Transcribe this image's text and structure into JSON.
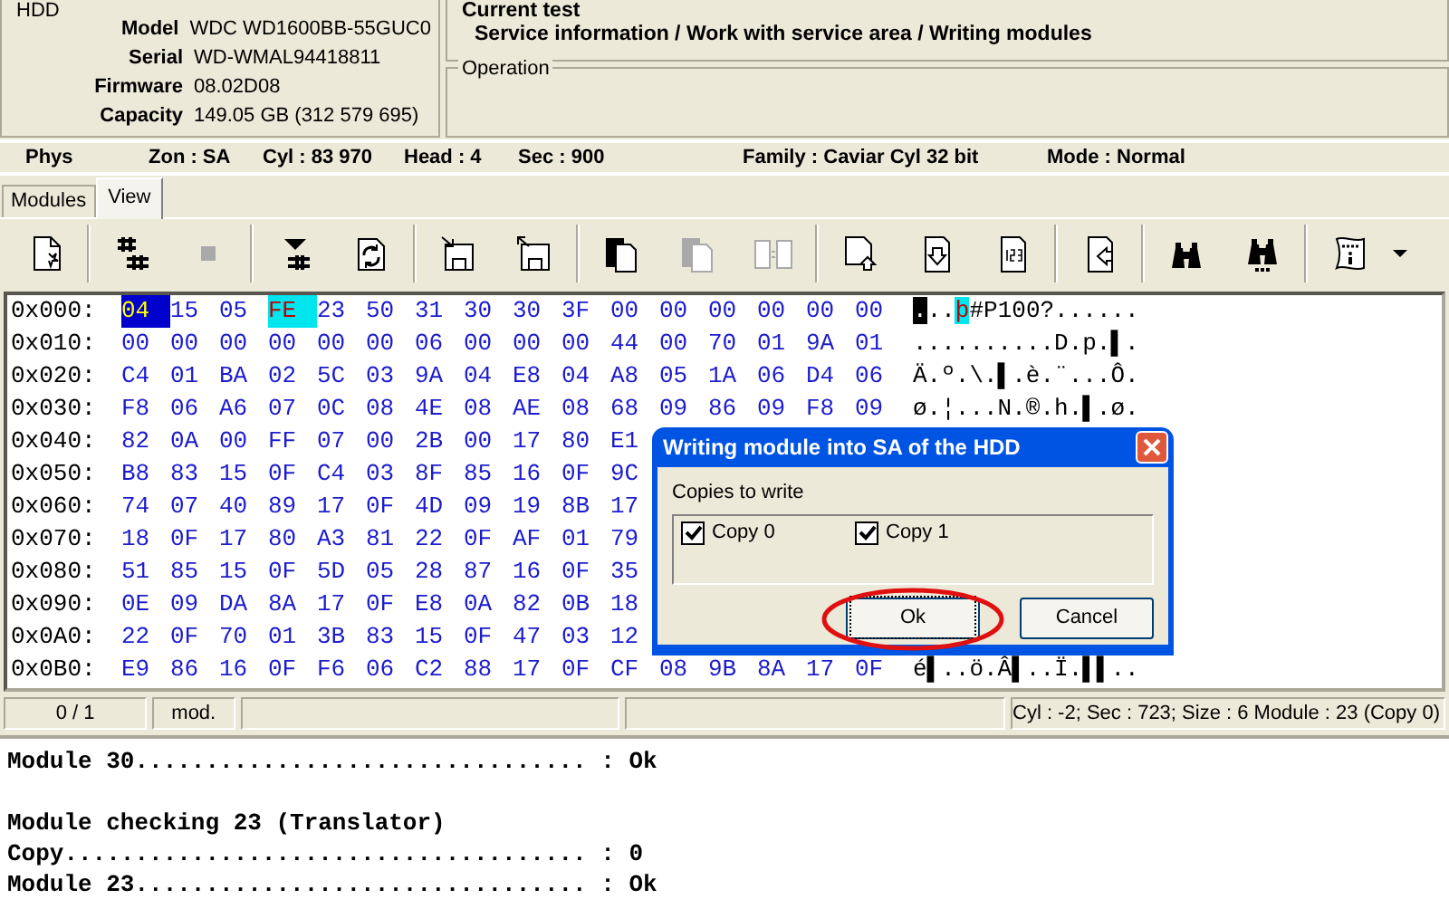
{
  "hdd": {
    "legend": "HDD",
    "fields": [
      {
        "label": "Model",
        "value": "WDC WD1600BB-55GUC0"
      },
      {
        "label": "Serial",
        "value": "WD-WMAL94418811"
      },
      {
        "label": "Firmware",
        "value": "08.02D08"
      },
      {
        "label": "Capacity",
        "value": "149.05 GB (312 579 695)"
      }
    ]
  },
  "current_test": {
    "legend": "Current test",
    "text": "Service information / Work with service area / Writing modules"
  },
  "operation": {
    "legend": "Operation"
  },
  "phys_bar": [
    "Phys",
    "Zon : SA",
    "Cyl : 83 970",
    "Head : 4",
    "Sec : 900",
    "Family : Caviar Cyl 32 bit",
    "Mode : Normal"
  ],
  "tabs": [
    {
      "label": "Modules",
      "selected": false
    },
    {
      "label": "View",
      "selected": true
    }
  ],
  "toolbar": [
    {
      "kind": "page-star",
      "disabled": false
    },
    {
      "kind": "separator"
    },
    {
      "kind": "hash",
      "disabled": false
    },
    {
      "kind": "stop",
      "disabled": true
    },
    {
      "kind": "separator"
    },
    {
      "kind": "arrow-lines",
      "disabled": false
    },
    {
      "kind": "refresh",
      "disabled": false
    },
    {
      "kind": "separator"
    },
    {
      "kind": "floppy-in",
      "disabled": false
    },
    {
      "kind": "floppy-out",
      "disabled": false
    },
    {
      "kind": "separator"
    },
    {
      "kind": "copy",
      "disabled": false
    },
    {
      "kind": "copy",
      "disabled": true
    },
    {
      "kind": "compare",
      "disabled": true
    },
    {
      "kind": "separator"
    },
    {
      "kind": "page-arrow",
      "disabled": false
    },
    {
      "kind": "page-down",
      "disabled": false
    },
    {
      "kind": "page-123",
      "disabled": false
    },
    {
      "kind": "separator"
    },
    {
      "kind": "page-back",
      "disabled": false
    },
    {
      "kind": "separator"
    },
    {
      "kind": "binoculars",
      "disabled": false
    },
    {
      "kind": "binoculars-dots",
      "disabled": false
    },
    {
      "kind": "separator"
    },
    {
      "kind": "scroll",
      "disabled": false
    },
    {
      "kind": "dropdown",
      "disabled": false
    }
  ],
  "hex_rows": [
    {
      "address": "0x000:",
      "bytes": [
        {
          "text": "04",
          "kind": "cursor"
        },
        "15",
        "05",
        {
          "text": "FE",
          "kind": "match"
        },
        "23",
        "50",
        "31",
        "30",
        "30",
        "3F",
        "00",
        "00",
        "00",
        "00",
        "00",
        "00"
      ],
      "ascii": [
        {
          "text": ".",
          "kind": "cursor"
        },
        {
          "text": "..",
          "kind": "plain"
        },
        {
          "text": "þ",
          "kind": "match"
        },
        {
          "text": "#P100?......",
          "kind": "plain"
        }
      ]
    },
    {
      "address": "0x010:",
      "bytes": [
        "00",
        "00",
        "00",
        "00",
        "00",
        "00",
        "06",
        "00",
        "00",
        "00",
        "44",
        "00",
        "70",
        "01",
        "9A",
        "01"
      ],
      "ascii": "..........D.p.▌."
    },
    {
      "address": "0x020:",
      "bytes": [
        "C4",
        "01",
        "BA",
        "02",
        "5C",
        "03",
        "9A",
        "04",
        "E8",
        "04",
        "A8",
        "05",
        "1A",
        "06",
        "D4",
        "06"
      ],
      "ascii": "Ä.º.\\.▌.è.¨...Ô."
    },
    {
      "address": "0x030:",
      "bytes": [
        "F8",
        "06",
        "A6",
        "07",
        "0C",
        "08",
        "4E",
        "08",
        "AE",
        "08",
        "68",
        "09",
        "86",
        "09",
        "F8",
        "09"
      ],
      "ascii": "ø.¦...N.®.h.▌.ø."
    },
    {
      "address": "0x040:",
      "bytes": [
        "82",
        "0A",
        "00",
        "FF",
        "07",
        "00",
        "2B",
        "00",
        "17",
        "80",
        "E1"
      ]
    },
    {
      "address": "0x050:",
      "bytes": [
        "B8",
        "83",
        "15",
        "0F",
        "C4",
        "03",
        "8F",
        "85",
        "16",
        "0F",
        "9C"
      ]
    },
    {
      "address": "0x060:",
      "bytes": [
        "74",
        "07",
        "40",
        "89",
        "17",
        "0F",
        "4D",
        "09",
        "19",
        "8B",
        "17"
      ]
    },
    {
      "address": "0x070:",
      "bytes": [
        "18",
        "0F",
        "17",
        "80",
        "A3",
        "81",
        "22",
        "0F",
        "AF",
        "01",
        "79"
      ]
    },
    {
      "address": "0x080:",
      "bytes": [
        "51",
        "85",
        "15",
        "0F",
        "5D",
        "05",
        "28",
        "87",
        "16",
        "0F",
        "35"
      ]
    },
    {
      "address": "0x090:",
      "bytes": [
        "0E",
        "09",
        "DA",
        "8A",
        "17",
        "0F",
        "E8",
        "0A",
        "82",
        "0B",
        "18"
      ]
    },
    {
      "address": "0x0A0:",
      "bytes": [
        "22",
        "0F",
        "70",
        "01",
        "3B",
        "83",
        "15",
        "0F",
        "47",
        "03",
        "12"
      ]
    },
    {
      "address": "0x0B0:",
      "bytes": [
        "E9",
        "86",
        "16",
        "0F",
        "F6",
        "06",
        "C2",
        "88",
        "17",
        "0F",
        "CF",
        "08",
        "9B",
        "8A",
        "17",
        "0F"
      ],
      "ascii": "é▌..ö.Â▌..Ï.▌▌.."
    }
  ],
  "status_bar": {
    "position": "0 / 1",
    "mode": "mod.",
    "info": "Cyl : -2; Sec : 723; Size : 6 Module : 23 (Copy 0)"
  },
  "log": [
    {
      "kind": "text",
      "text": "Module 30................................ : Ok"
    },
    {
      "kind": "blank"
    },
    {
      "kind": "text",
      "text": "Module checking 23 (Translator)"
    },
    {
      "kind": "text",
      "text": "Copy..................................... : 0"
    },
    {
      "kind": "text",
      "text": "Module 23................................ : Ok"
    }
  ],
  "dialog": {
    "title": "Writing module into SA of the HDD",
    "group_label": "Copies to write",
    "copies": [
      {
        "label": "Copy 0",
        "checked": true
      },
      {
        "label": "Copy 1",
        "checked": true
      }
    ],
    "buttons": [
      {
        "label": "Ok",
        "focused": true
      },
      {
        "label": "Cancel",
        "focused": false
      }
    ],
    "annotation": {
      "kind": "ellipse"
    }
  }
}
